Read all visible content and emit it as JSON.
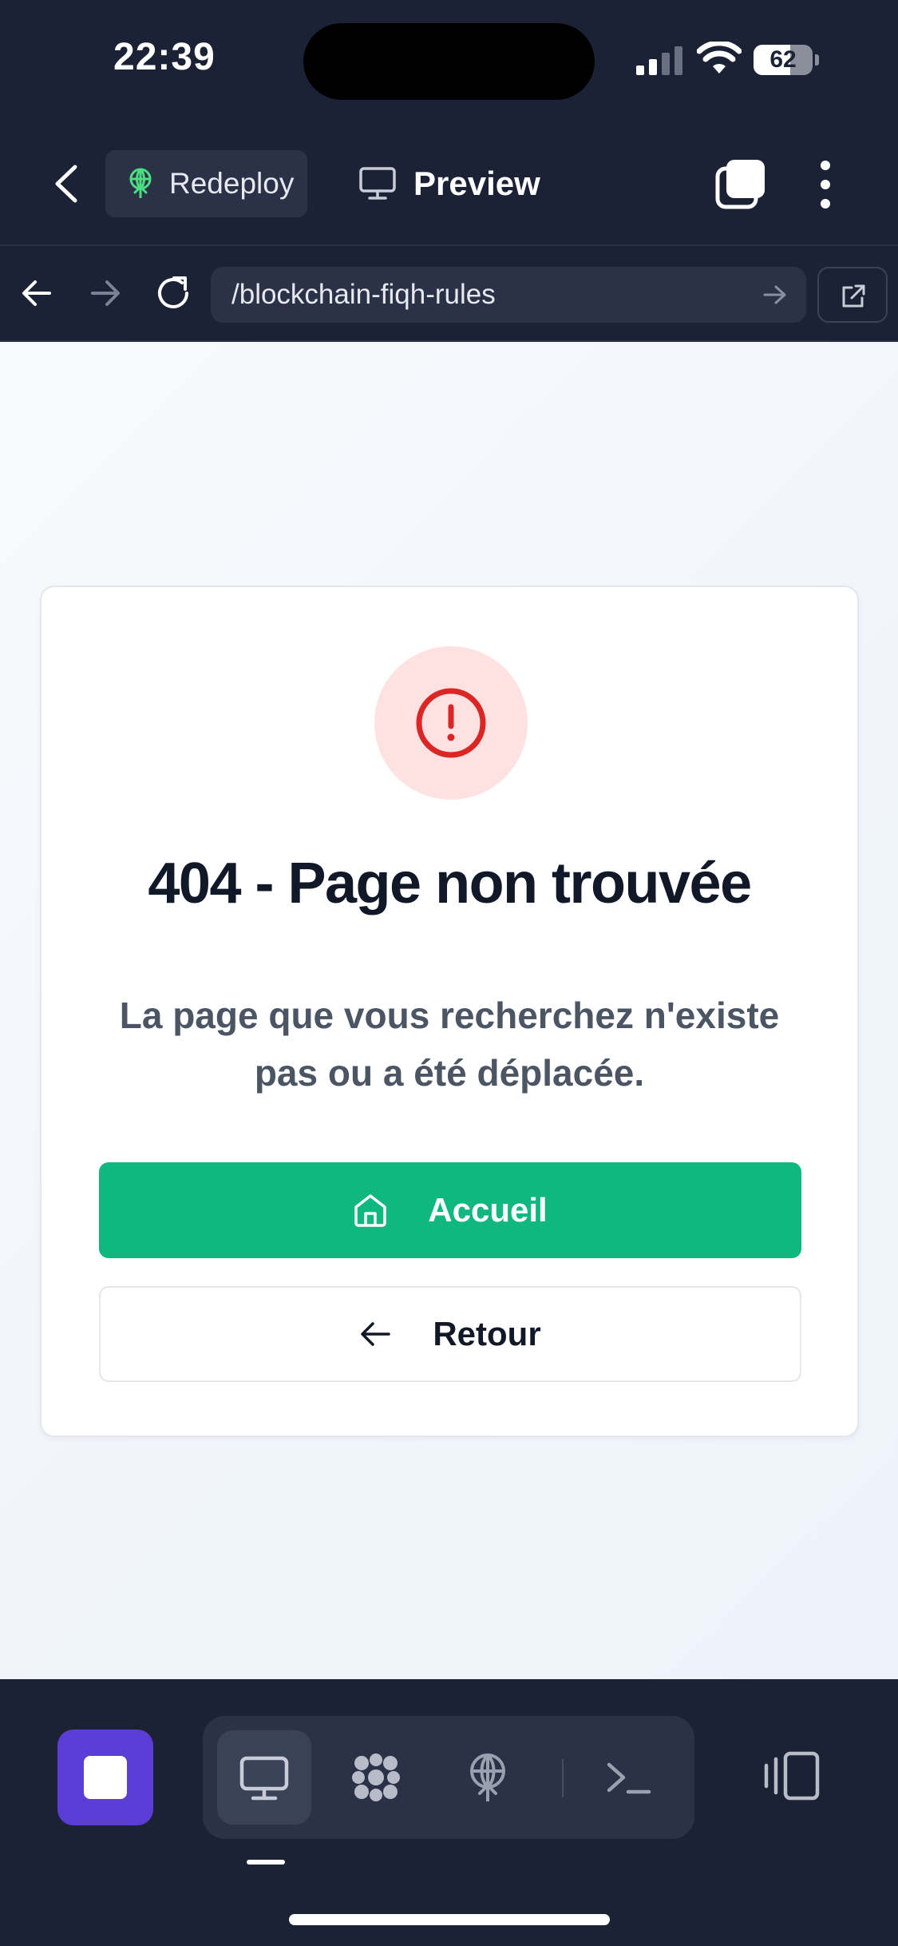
{
  "status_bar": {
    "time": "22:39",
    "battery_percent": 62
  },
  "toolbar": {
    "redeploy_label": "Redeploy",
    "preview_label": "Preview"
  },
  "urlbar": {
    "url": "/blockchain-fiqh-rules"
  },
  "error_card": {
    "title": "404 - Page non trouvée",
    "message": "La page que vous recherchez n'existe pas ou a été déplacée.",
    "home_label": "Accueil",
    "back_label": "Retour"
  },
  "dock": {
    "items": [
      "monitor-icon",
      "nodes-icon",
      "deploy-icon",
      "terminal-icon"
    ],
    "active_item": "monitor-icon"
  },
  "colors": {
    "chrome_background": "#1c2235",
    "accent_purple": "#5b3ed6",
    "primary_green": "#10b77f",
    "alert_red": "#dc2626",
    "alert_background": "#fee2e2"
  }
}
